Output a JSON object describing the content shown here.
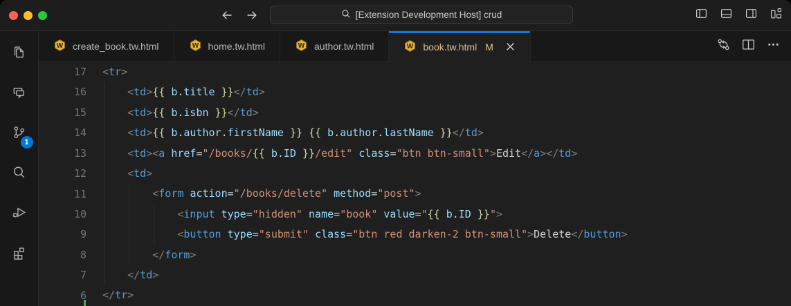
{
  "titlebar": {
    "traffic_lights": [
      {
        "name": "close",
        "color": "#ff5f57"
      },
      {
        "name": "minimize",
        "color": "#febc2e"
      },
      {
        "name": "zoom",
        "color": "#28c840"
      }
    ],
    "search_text": "[Extension Development Host] crud",
    "action_icons": [
      "toggle-primary-sidebar",
      "toggle-panel",
      "toggle-secondary-sidebar",
      "customize-layout"
    ]
  },
  "activity_bar": {
    "items": [
      {
        "name": "explorer"
      },
      {
        "name": "chat"
      },
      {
        "name": "source-control",
        "badge": "1"
      },
      {
        "name": "search"
      },
      {
        "name": "run-and-debug"
      },
      {
        "name": "extensions"
      }
    ],
    "badge_color": "#0078d4"
  },
  "tabs": [
    {
      "label": "create_book.tw.html",
      "active": false
    },
    {
      "label": "home.tw.html",
      "active": false
    },
    {
      "label": "author.tw.html",
      "active": false
    },
    {
      "label": "book.tw.html",
      "active": true,
      "git_status": "M",
      "closable": true
    }
  ],
  "tab_actions": [
    "open-changes",
    "split-editor",
    "more-actions"
  ],
  "colors": {
    "active_tab_stripe": "#0c7bd8",
    "modified_file": "#e2c08d",
    "scm_badge": "#0078d4",
    "git_added_gutter": "#4fa74f",
    "syntax": {
      "tag": "#569cd6",
      "attribute": "#9cdcfe",
      "string": "#ce9178",
      "template_braces": "#d8d8a2",
      "variable": "#9cdcfe",
      "punctuation": "#808080",
      "text": "#d4d4d4"
    }
  },
  "editor": {
    "lines": [
      {
        "num": "17",
        "tokens": [
          [
            "p",
            "<"
          ],
          [
            "tag",
            "tr"
          ],
          [
            "p",
            ">"
          ]
        ]
      },
      {
        "num": "16",
        "tokens": [
          [
            "txt",
            "    "
          ],
          [
            "p",
            "<"
          ],
          [
            "tag",
            "td"
          ],
          [
            "p",
            ">"
          ],
          [
            "tmpl",
            "{{"
          ],
          [
            "txt",
            " "
          ],
          [
            "var",
            "b"
          ],
          [
            "txt",
            "."
          ],
          [
            "var",
            "title"
          ],
          [
            "txt",
            " "
          ],
          [
            "tmpl",
            "}}"
          ],
          [
            "p",
            "</"
          ],
          [
            "tag",
            "td"
          ],
          [
            "p",
            ">"
          ]
        ]
      },
      {
        "num": "15",
        "tokens": [
          [
            "txt",
            "    "
          ],
          [
            "p",
            "<"
          ],
          [
            "tag",
            "td"
          ],
          [
            "p",
            ">"
          ],
          [
            "tmpl",
            "{{"
          ],
          [
            "txt",
            " "
          ],
          [
            "var",
            "b"
          ],
          [
            "txt",
            "."
          ],
          [
            "var",
            "isbn"
          ],
          [
            "txt",
            " "
          ],
          [
            "tmpl",
            "}}"
          ],
          [
            "p",
            "</"
          ],
          [
            "tag",
            "td"
          ],
          [
            "p",
            ">"
          ]
        ]
      },
      {
        "num": "14",
        "tokens": [
          [
            "txt",
            "    "
          ],
          [
            "p",
            "<"
          ],
          [
            "tag",
            "td"
          ],
          [
            "p",
            ">"
          ],
          [
            "tmpl",
            "{{"
          ],
          [
            "txt",
            " "
          ],
          [
            "var",
            "b"
          ],
          [
            "txt",
            "."
          ],
          [
            "var",
            "author"
          ],
          [
            "txt",
            "."
          ],
          [
            "var",
            "firstName"
          ],
          [
            "txt",
            " "
          ],
          [
            "tmpl",
            "}}"
          ],
          [
            "txt",
            " "
          ],
          [
            "tmpl",
            "{{"
          ],
          [
            "txt",
            " "
          ],
          [
            "var",
            "b"
          ],
          [
            "txt",
            "."
          ],
          [
            "var",
            "author"
          ],
          [
            "txt",
            "."
          ],
          [
            "var",
            "lastName"
          ],
          [
            "txt",
            " "
          ],
          [
            "tmpl",
            "}}"
          ],
          [
            "p",
            "</"
          ],
          [
            "tag",
            "td"
          ],
          [
            "p",
            ">"
          ]
        ]
      },
      {
        "num": "13",
        "tokens": [
          [
            "txt",
            "    "
          ],
          [
            "p",
            "<"
          ],
          [
            "tag",
            "td"
          ],
          [
            "p",
            ">"
          ],
          [
            "p",
            "<"
          ],
          [
            "tag",
            "a"
          ],
          [
            "txt",
            " "
          ],
          [
            "attr",
            "href"
          ],
          [
            "eq",
            "="
          ],
          [
            "str",
            "\"/books/"
          ],
          [
            "tmpl",
            "{{"
          ],
          [
            "txt",
            " "
          ],
          [
            "var",
            "b"
          ],
          [
            "txt",
            "."
          ],
          [
            "var",
            "ID"
          ],
          [
            "txt",
            " "
          ],
          [
            "tmpl",
            "}}"
          ],
          [
            "str",
            "/edit\""
          ],
          [
            "txt",
            " "
          ],
          [
            "attr",
            "class"
          ],
          [
            "eq",
            "="
          ],
          [
            "str",
            "\"btn btn-small\""
          ],
          [
            "p",
            ">"
          ],
          [
            "txt",
            "Edit"
          ],
          [
            "p",
            "</"
          ],
          [
            "tag",
            "a"
          ],
          [
            "p",
            ">"
          ],
          [
            "p",
            "</"
          ],
          [
            "tag",
            "td"
          ],
          [
            "p",
            ">"
          ]
        ]
      },
      {
        "num": "12",
        "tokens": [
          [
            "txt",
            "    "
          ],
          [
            "p",
            "<"
          ],
          [
            "tag",
            "td"
          ],
          [
            "p",
            ">"
          ]
        ]
      },
      {
        "num": "11",
        "tokens": [
          [
            "txt",
            "        "
          ],
          [
            "p",
            "<"
          ],
          [
            "tag",
            "form"
          ],
          [
            "txt",
            " "
          ],
          [
            "attr",
            "action"
          ],
          [
            "eq",
            "="
          ],
          [
            "str",
            "\"/books/delete\""
          ],
          [
            "txt",
            " "
          ],
          [
            "attr",
            "method"
          ],
          [
            "eq",
            "="
          ],
          [
            "str",
            "\"post\""
          ],
          [
            "p",
            ">"
          ]
        ]
      },
      {
        "num": "10",
        "tokens": [
          [
            "txt",
            "            "
          ],
          [
            "p",
            "<"
          ],
          [
            "tag",
            "input"
          ],
          [
            "txt",
            " "
          ],
          [
            "attr",
            "type"
          ],
          [
            "eq",
            "="
          ],
          [
            "str",
            "\"hidden\""
          ],
          [
            "txt",
            " "
          ],
          [
            "attr",
            "name"
          ],
          [
            "eq",
            "="
          ],
          [
            "str",
            "\"book\""
          ],
          [
            "txt",
            " "
          ],
          [
            "attr",
            "value"
          ],
          [
            "eq",
            "="
          ],
          [
            "str",
            "\""
          ],
          [
            "tmpl",
            "{{"
          ],
          [
            "txt",
            " "
          ],
          [
            "var",
            "b"
          ],
          [
            "txt",
            "."
          ],
          [
            "var",
            "ID"
          ],
          [
            "txt",
            " "
          ],
          [
            "tmpl",
            "}}"
          ],
          [
            "str",
            "\""
          ],
          [
            "p",
            ">"
          ]
        ]
      },
      {
        "num": "9",
        "tokens": [
          [
            "txt",
            "            "
          ],
          [
            "p",
            "<"
          ],
          [
            "tag",
            "button"
          ],
          [
            "txt",
            " "
          ],
          [
            "attr",
            "type"
          ],
          [
            "eq",
            "="
          ],
          [
            "str",
            "\"submit\""
          ],
          [
            "txt",
            " "
          ],
          [
            "attr",
            "class"
          ],
          [
            "eq",
            "="
          ],
          [
            "str",
            "\"btn red darken-2 btn-small\""
          ],
          [
            "p",
            ">"
          ],
          [
            "txt",
            "Delete"
          ],
          [
            "p",
            "</"
          ],
          [
            "tag",
            "button"
          ],
          [
            "p",
            ">"
          ]
        ]
      },
      {
        "num": "8",
        "tokens": [
          [
            "txt",
            "        "
          ],
          [
            "p",
            "</"
          ],
          [
            "tag",
            "form"
          ],
          [
            "p",
            ">"
          ]
        ]
      },
      {
        "num": "7",
        "tokens": [
          [
            "txt",
            "    "
          ],
          [
            "p",
            "</"
          ],
          [
            "tag",
            "td"
          ],
          [
            "p",
            ">"
          ]
        ]
      },
      {
        "num": "6",
        "tokens": [
          [
            "p",
            "</"
          ],
          [
            "tag",
            "tr"
          ],
          [
            "p",
            ">"
          ]
        ]
      }
    ]
  }
}
